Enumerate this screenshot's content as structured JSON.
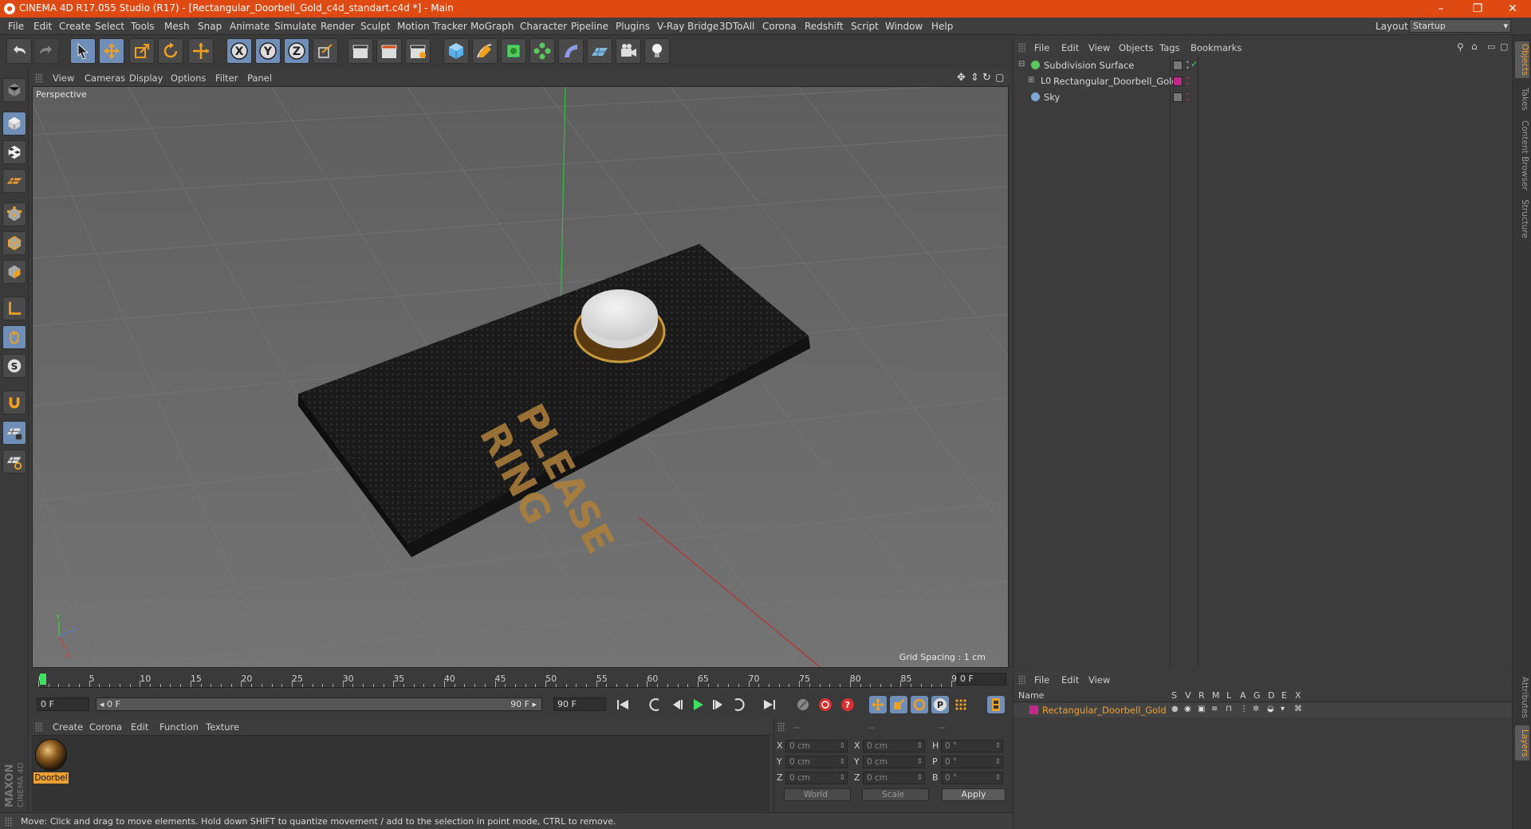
{
  "window": {
    "title": "CINEMA 4D R17.055 Studio (R17) - [Rectangular_Doorbell_Gold_c4d_standart.c4d *] - Main",
    "minimize": "–",
    "restore": "❐",
    "close": "✕"
  },
  "menu": [
    "File",
    "Edit",
    "Create",
    "Select",
    "Tools",
    "Mesh",
    "Snap",
    "Animate",
    "Simulate",
    "Render",
    "Sculpt",
    "Motion Tracker",
    "MoGraph",
    "Character",
    "Pipeline",
    "Plugins",
    "V-Ray Bridge",
    "3DToAll",
    "Corona",
    "Redshift",
    "Script",
    "Window",
    "Help"
  ],
  "layout": {
    "label": "Layout:",
    "value": "Startup"
  },
  "viewport": {
    "menu": [
      "View",
      "Cameras",
      "Display",
      "Options",
      "Filter",
      "Panel"
    ],
    "label": "Perspective",
    "grid_spacing": "Grid Spacing : 1 cm",
    "sign_text": [
      "PLEASE",
      "RING"
    ],
    "axis": {
      "y": "Y",
      "z": "Z",
      "x": "X"
    }
  },
  "timeline": {
    "ticks": [
      "0",
      "5",
      "10",
      "15",
      "20",
      "25",
      "30",
      "35",
      "40",
      "45",
      "50",
      "55",
      "60",
      "65",
      "70",
      "75",
      "80",
      "85",
      "90"
    ],
    "frame": "0 F"
  },
  "transport": {
    "start": "0 F",
    "range_start": "◂ 0 F",
    "range_end": "90 F ▸",
    "end": "90 F"
  },
  "materials": {
    "menu": [
      "Create",
      "Corona",
      "Edit",
      "Function",
      "Texture"
    ],
    "items": [
      {
        "name": "Doorbel"
      }
    ]
  },
  "coordinates": {
    "header": [
      "--",
      "--",
      "--"
    ],
    "rows": [
      {
        "a": "X",
        "av": "0 cm",
        "b": "X",
        "bv": "0 cm",
        "c": "H",
        "cv": "0 °"
      },
      {
        "a": "Y",
        "av": "0 cm",
        "b": "Y",
        "bv": "0 cm",
        "c": "P",
        "cv": "0 °"
      },
      {
        "a": "Z",
        "av": "0 cm",
        "b": "Z",
        "bv": "0 cm",
        "c": "B",
        "cv": "0 °"
      }
    ],
    "world": "World",
    "scale": "Scale",
    "apply": "Apply"
  },
  "status": "Move: Click and drag to move elements. Hold down SHIFT to quantize movement / add to the selection in point mode, CTRL to remove.",
  "objects": {
    "menu": [
      "File",
      "Edit",
      "View",
      "Objects",
      "Tags",
      "Bookmarks"
    ],
    "items": [
      {
        "name": "Subdivision Surface",
        "color": "#6fcf6f"
      },
      {
        "name": "Rectangular_Doorbell_Gold",
        "color": "#cfcfcf"
      },
      {
        "name": "Sky",
        "color": "#7fa8d8"
      }
    ]
  },
  "layers": {
    "menu": [
      "File",
      "Edit",
      "View"
    ],
    "headers": [
      "Name",
      "S",
      "V",
      "R",
      "M",
      "L",
      "A",
      "G",
      "D",
      "E",
      "X"
    ],
    "row": "Rectangular_Doorbell_Gold",
    "accent": "#f0a030"
  },
  "side_tabs": [
    "Objects",
    "Takes",
    "Content Browser",
    "Structure",
    "Attributes",
    "Layers"
  ],
  "logo": {
    "brand": "MAXON",
    "product": "CINEMA 4D"
  }
}
